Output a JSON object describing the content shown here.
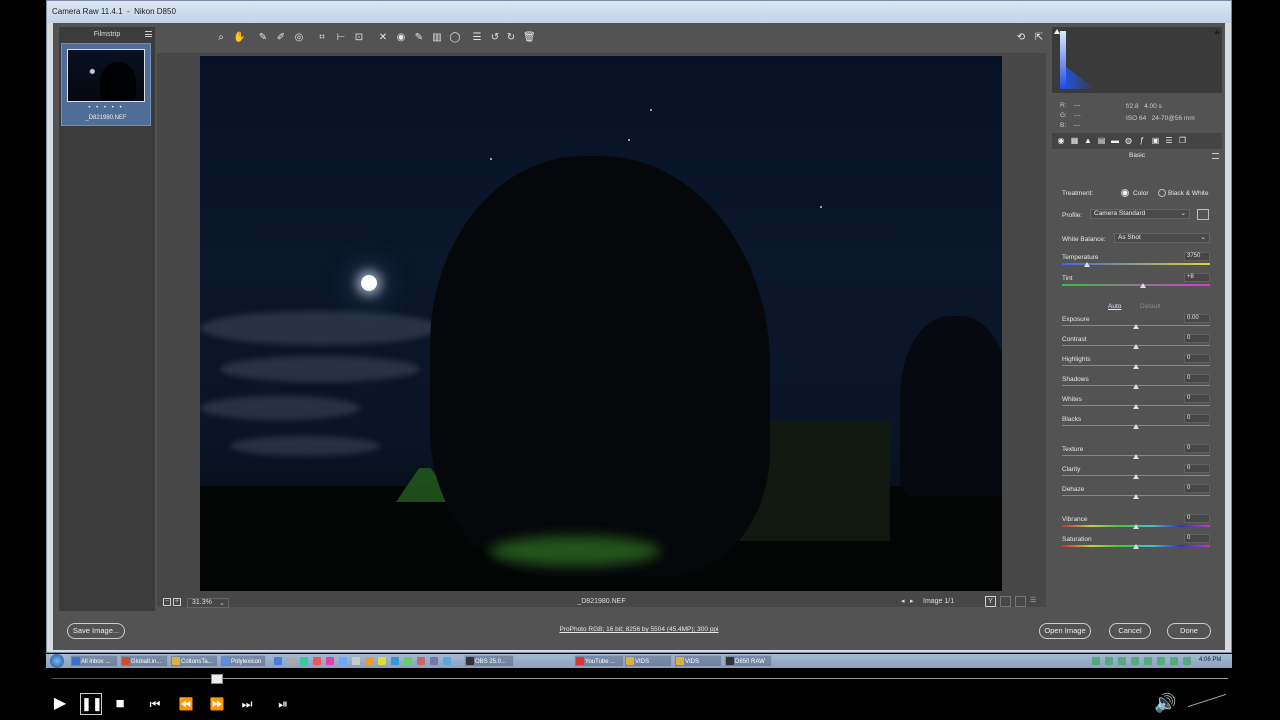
{
  "window": {
    "title": "Camera Raw 11.4.1  -  Nikon D850"
  },
  "filmstrip": {
    "header": "Filmstrip",
    "menu_icon": "hamburger-icon",
    "rating": "• • • • •",
    "thumb_name": "_D821980.NEF"
  },
  "toolbar": {
    "icons": [
      "zoom-icon",
      "hand-icon",
      "white-balance-icon",
      "color-sampler-icon",
      "targeted-adjust-icon",
      "crop-icon",
      "straighten-icon",
      "transform-icon",
      "spot-removal-icon",
      "red-eye-icon",
      "adjustment-brush-icon",
      "graduated-filter-icon",
      "radial-filter-icon",
      "preferences-icon",
      "rotate-left-icon",
      "rotate-right-icon",
      "trash-icon"
    ],
    "right_icons": [
      "toggle-fullscreen-icon",
      "export-icon"
    ]
  },
  "status": {
    "zoom": "31.3%",
    "filename": "_D821980.NEF",
    "image_count": "Image 1/1"
  },
  "histogram": {
    "r": "R:",
    "g": "G:",
    "b": "B:",
    "r_val": "---",
    "g_val": "---",
    "b_val": "---",
    "aperture": "f/2.8",
    "shutter": "4.00 s",
    "iso": "ISO 64",
    "lens": "24-70@56 mm"
  },
  "panel": {
    "title": "Basic",
    "treatment_label": "Treatment:",
    "treatment_color": "Color",
    "treatment_bw": "Black & White",
    "profile_label": "Profile:",
    "profile_value": "Camera Standard",
    "wb_label": "White Balance:",
    "wb_value": "As Shot",
    "auto": "Auto",
    "default": "Default",
    "sliders": [
      {
        "label": "Temperature",
        "value": "3750",
        "level": 0.17
      },
      {
        "label": "Tint",
        "value": "+8",
        "level": 0.55
      },
      {
        "label": "Exposure",
        "value": "0.00",
        "level": 0.5
      },
      {
        "label": "Contrast",
        "value": "0",
        "level": 0.5
      },
      {
        "label": "Highlights",
        "value": "0",
        "level": 0.5
      },
      {
        "label": "Shadows",
        "value": "0",
        "level": 0.5
      },
      {
        "label": "Whites",
        "value": "0",
        "level": 0.5
      },
      {
        "label": "Blacks",
        "value": "0",
        "level": 0.5
      },
      {
        "label": "Texture",
        "value": "0",
        "level": 0.5
      },
      {
        "label": "Clarity",
        "value": "0",
        "level": 0.5
      },
      {
        "label": "Dehaze",
        "value": "0",
        "level": 0.5
      },
      {
        "label": "Vibrance",
        "value": "0",
        "level": 0.5
      },
      {
        "label": "Saturation",
        "value": "0",
        "level": 0.5
      }
    ]
  },
  "footer": {
    "save": "Save Image...",
    "workflow": "ProPhoto RGB; 16 bit; 8256 by 5504 (45.4MP); 300 ppi",
    "open": "Open Image",
    "cancel": "Cancel",
    "done": "Done"
  },
  "taskbar": {
    "items": [
      "All inbox ...",
      "Globalt.in...",
      "ColtonsTa...",
      "Polylexicon",
      "OBS 25.0...",
      "YouTube ...",
      "VIDS",
      "VIDS",
      "D850 RAW"
    ],
    "clock": "4:06 PM"
  },
  "player": {
    "progress": 0.14
  }
}
